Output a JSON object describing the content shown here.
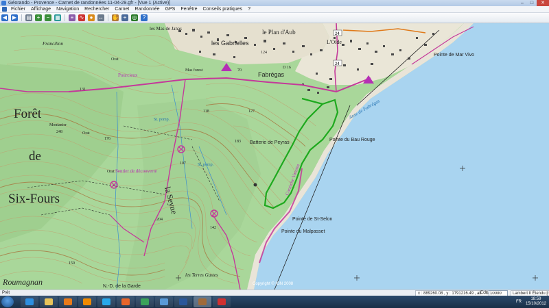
{
  "window": {
    "title": "Géorando - Provence - Carnet de randonnées 11-04-29.gfr - [Vue 1 (Active)]",
    "controls": [
      "–",
      "□",
      "✕"
    ]
  },
  "menu": [
    "Fichier",
    "Affichage",
    "Navigation",
    "Rechercher",
    "Carnet",
    "Randonnée",
    "GPS",
    "Fenêtre",
    "Conseils pratiques",
    "?"
  ],
  "toolbar_icons": [
    {
      "name": "navigate-back-icon",
      "color": "#2e6fc9",
      "glyph": "◀"
    },
    {
      "name": "navigate-forward-icon",
      "color": "#2e6fc9",
      "glyph": "▶"
    },
    {
      "name": "print-icon",
      "color": "#6b7a8c",
      "glyph": "▤"
    },
    {
      "name": "zoom-in-icon",
      "color": "#3b8f3b",
      "glyph": "+"
    },
    {
      "name": "zoom-out-icon",
      "color": "#3b8f3b",
      "glyph": "−"
    },
    {
      "name": "map-icon",
      "color": "#2b9a9a",
      "glyph": "▦"
    },
    {
      "name": "layers-icon",
      "color": "#8a5aa8",
      "glyph": "≡"
    },
    {
      "name": "track-icon",
      "color": "#cc3333",
      "glyph": "∿"
    },
    {
      "name": "waypoint-icon",
      "color": "#d98a1a",
      "glyph": "●"
    },
    {
      "name": "measure-icon",
      "color": "#6b7a8c",
      "glyph": "↔"
    },
    {
      "name": "hand-pan-icon",
      "color": "#b07a3a",
      "glyph": "✋"
    },
    {
      "name": "select-icon",
      "color": "#4a6a9a",
      "glyph": "⌖"
    },
    {
      "name": "gps-icon",
      "color": "#2a7a2a",
      "glyph": "◎"
    },
    {
      "name": "help-icon",
      "color": "#2e6fc9",
      "glyph": "?"
    }
  ],
  "map": {
    "labels": {
      "les_mas_de_janas": "les Mas de Janas",
      "les_gabrielles": "les Gabrielles",
      "le_plan_daub": "le Plan d'Aub",
      "loide": "L'Oïde",
      "pointe_de_mar_vivo": "Pointe de Mar Vivo",
      "francillon": "Francillon",
      "orat_1": "Orat",
      "pourcieux": "Pourcieux",
      "fabregas": "Fabrégas",
      "mas_forest": "Mas forest",
      "foret": "Forêt",
      "de": "de",
      "six_fours": "Six-Fours",
      "anse_de_fabregas": "Anse de Fabrégas",
      "pointe_du_bau_rouge": "Pointe du Bau Rouge",
      "batterie_de_peyras": "Batterie de Peyras",
      "montanier": "Montanier",
      "sentier_de_decouverte": "Sentier de découverte",
      "corniche_varoise": "Corniche Varoise",
      "pointe_de_st_selon": "Pointe de St-Selon",
      "pointe_du_malpasset": "Pointe du Malpasset",
      "la_seyne": "la Seyne",
      "roumagnan": "Roumagnan",
      "nd_de_la_garde": "N.-D. de la Garde",
      "les_terres_gastes": "les Terres Gastes",
      "copyright": "Copyright © IGN 2008",
      "orat_2": "Orat",
      "orat_3": "Orat",
      "st_pomp_1": "St. pomp.",
      "st_pomp_2": "St. pomp.",
      "elev_248": "248",
      "elev_176": "176",
      "elev_183": "183",
      "elev_127": "127",
      "elev_107": "107",
      "elev_204": "204",
      "elev_159": "159",
      "elev_142": "142",
      "elev_118": "118",
      "elev_131": "131",
      "elev_70": "70",
      "elev_124": "124",
      "route_24a": "24",
      "route_24b": "24",
      "route_d16": "D 16"
    }
  },
  "status": {
    "text": "Prêt",
    "coords": "x : 889260.08 , y : 1791216.49 , alt. : 0 m",
    "scale_label": "Ech. 1:",
    "scale_value": "10000",
    "projection": "Lambert II Étendu [m]"
  },
  "taskbar": {
    "items": [
      {
        "name": "ie-taskbar-icon",
        "color": "#2d8fe0"
      },
      {
        "name": "explorer-taskbar-icon",
        "color": "#e8c35a"
      },
      {
        "name": "media-player-taskbar-icon",
        "color": "#e87a1a"
      },
      {
        "name": "vlc-taskbar-icon",
        "color": "#f08a00"
      },
      {
        "name": "skype-taskbar-icon",
        "color": "#28a8ea"
      },
      {
        "name": "firefox-taskbar-icon",
        "color": "#e8652a"
      },
      {
        "name": "chrome-taskbar-icon",
        "color": "#3ba35a"
      },
      {
        "name": "paint-taskbar-icon",
        "color": "#5a9ad8"
      },
      {
        "name": "word-taskbar-icon",
        "color": "#2b579a"
      },
      {
        "name": "georando-taskbar-icon",
        "color": "#a06a3a"
      },
      {
        "name": "app-red-taskbar-icon",
        "color": "#d03030"
      }
    ],
    "lang": "FR",
    "time": "18:59",
    "date": "15/10/2012"
  }
}
